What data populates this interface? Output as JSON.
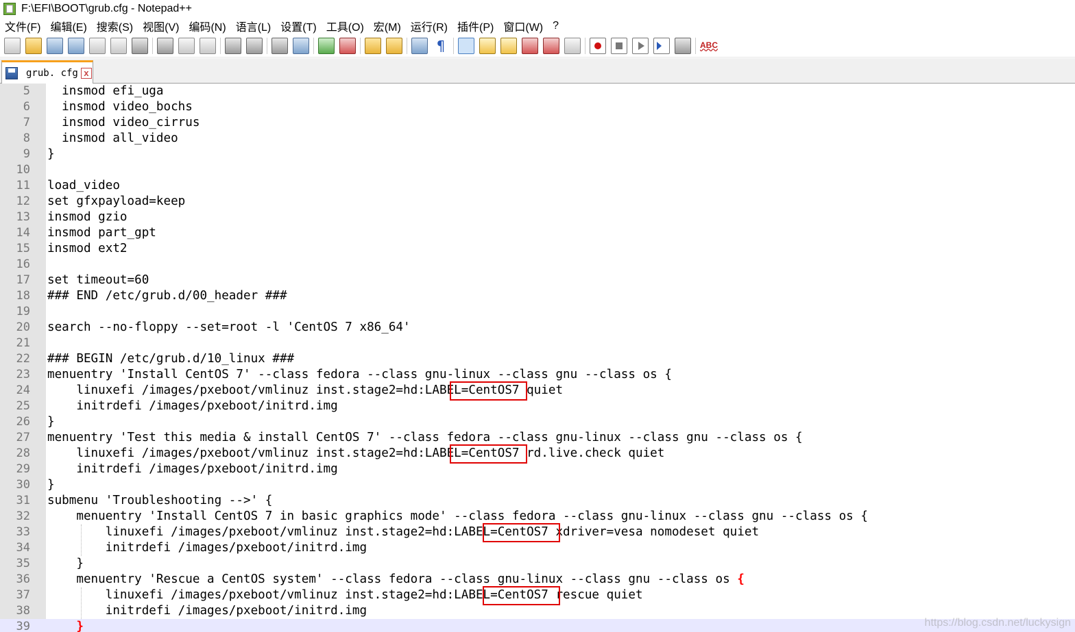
{
  "window": {
    "title": "F:\\EFI\\BOOT\\grub.cfg - Notepad++"
  },
  "menu": [
    "文件(F)",
    "编辑(E)",
    "搜索(S)",
    "视图(V)",
    "编码(N)",
    "语言(L)",
    "设置(T)",
    "工具(O)",
    "宏(M)",
    "运行(R)",
    "插件(P)",
    "窗口(W)",
    "?"
  ],
  "toolbar": {
    "buttons": [
      "new-file",
      "open-file",
      "save",
      "save-all",
      "close",
      "close-all",
      "print",
      "|",
      "cut",
      "copy",
      "paste",
      "|",
      "undo",
      "redo",
      "|",
      "find",
      "replace",
      "|",
      "zoom-in",
      "zoom-out",
      "|",
      "sync-vertical",
      "sync-horizontal",
      "|",
      "word-wrap",
      "show-all-chars",
      "|",
      "indent-guide",
      "doc-map",
      "function-list",
      "folder-workspace",
      "folder",
      "monitor",
      "|",
      "record-macro",
      "stop-recording",
      "play-macro",
      "run-macro-multiple",
      "save-macro",
      "|",
      "spell-check"
    ],
    "active": [
      "indent-guide"
    ]
  },
  "tab": {
    "label": "grub. cfg",
    "close": "x"
  },
  "editor": {
    "lines": [
      {
        "n": "5",
        "text": "  insmod efi_uga"
      },
      {
        "n": "6",
        "text": "  insmod video_bochs"
      },
      {
        "n": "7",
        "text": "  insmod video_cirrus"
      },
      {
        "n": "8",
        "text": "  insmod all_video"
      },
      {
        "n": "9",
        "text": "}"
      },
      {
        "n": "10",
        "text": ""
      },
      {
        "n": "11",
        "text": "load_video"
      },
      {
        "n": "12",
        "text": "set gfxpayload=keep"
      },
      {
        "n": "13",
        "text": "insmod gzio"
      },
      {
        "n": "14",
        "text": "insmod part_gpt"
      },
      {
        "n": "15",
        "text": "insmod ext2"
      },
      {
        "n": "16",
        "text": ""
      },
      {
        "n": "17",
        "text": "set timeout=60"
      },
      {
        "n": "18",
        "text": "### END /etc/grub.d/00_header ###"
      },
      {
        "n": "19",
        "text": ""
      },
      {
        "n": "20",
        "text": "search --no-floppy --set=root -l 'CentOS 7 x86_64'"
      },
      {
        "n": "21",
        "text": ""
      },
      {
        "n": "22",
        "text": "### BEGIN /etc/grub.d/10_linux ###"
      },
      {
        "n": "23",
        "text": "menuentry 'Install CentOS 7' --class fedora --class gnu-linux --class gnu --class os {"
      },
      {
        "n": "24",
        "text": "    linuxefi /images/pxeboot/vmlinuz inst.stage2=hd:LABEL=CentOS7 quiet"
      },
      {
        "n": "25",
        "text": "    initrdefi /images/pxeboot/initrd.img"
      },
      {
        "n": "26",
        "text": "}"
      },
      {
        "n": "27",
        "text": "menuentry 'Test this media & install CentOS 7' --class fedora --class gnu-linux --class gnu --class os {"
      },
      {
        "n": "28",
        "text": "    linuxefi /images/pxeboot/vmlinuz inst.stage2=hd:LABEL=CentOS7 rd.live.check quiet"
      },
      {
        "n": "29",
        "text": "    initrdefi /images/pxeboot/initrd.img"
      },
      {
        "n": "30",
        "text": "}"
      },
      {
        "n": "31",
        "text": "submenu 'Troubleshooting -->' {"
      },
      {
        "n": "32",
        "text": "    menuentry 'Install CentOS 7 in basic graphics mode' --class fedora --class gnu-linux --class gnu --class os {"
      },
      {
        "n": "33",
        "text": "        linuxefi /images/pxeboot/vmlinuz inst.stage2=hd:LABEL=CentOS7 xdriver=vesa nomodeset quiet"
      },
      {
        "n": "34",
        "text": "        initrdefi /images/pxeboot/initrd.img"
      },
      {
        "n": "35",
        "text": "    }"
      },
      {
        "n": "36",
        "text": "    menuentry 'Rescue a CentOS system' --class fedora --class gnu-linux --class gnu --class os ",
        "tail": "{"
      },
      {
        "n": "37",
        "text": "        linuxefi /images/pxeboot/vmlinuz inst.stage2=hd:LABEL=CentOS7 rescue quiet"
      },
      {
        "n": "38",
        "text": "        initrdefi /images/pxeboot/initrd.img"
      },
      {
        "n": "39",
        "text": "    ",
        "tail": "}"
      }
    ],
    "current_line": "39",
    "highlight_color": "#e00000"
  },
  "watermark": "https://blog.csdn.net/luckysign"
}
